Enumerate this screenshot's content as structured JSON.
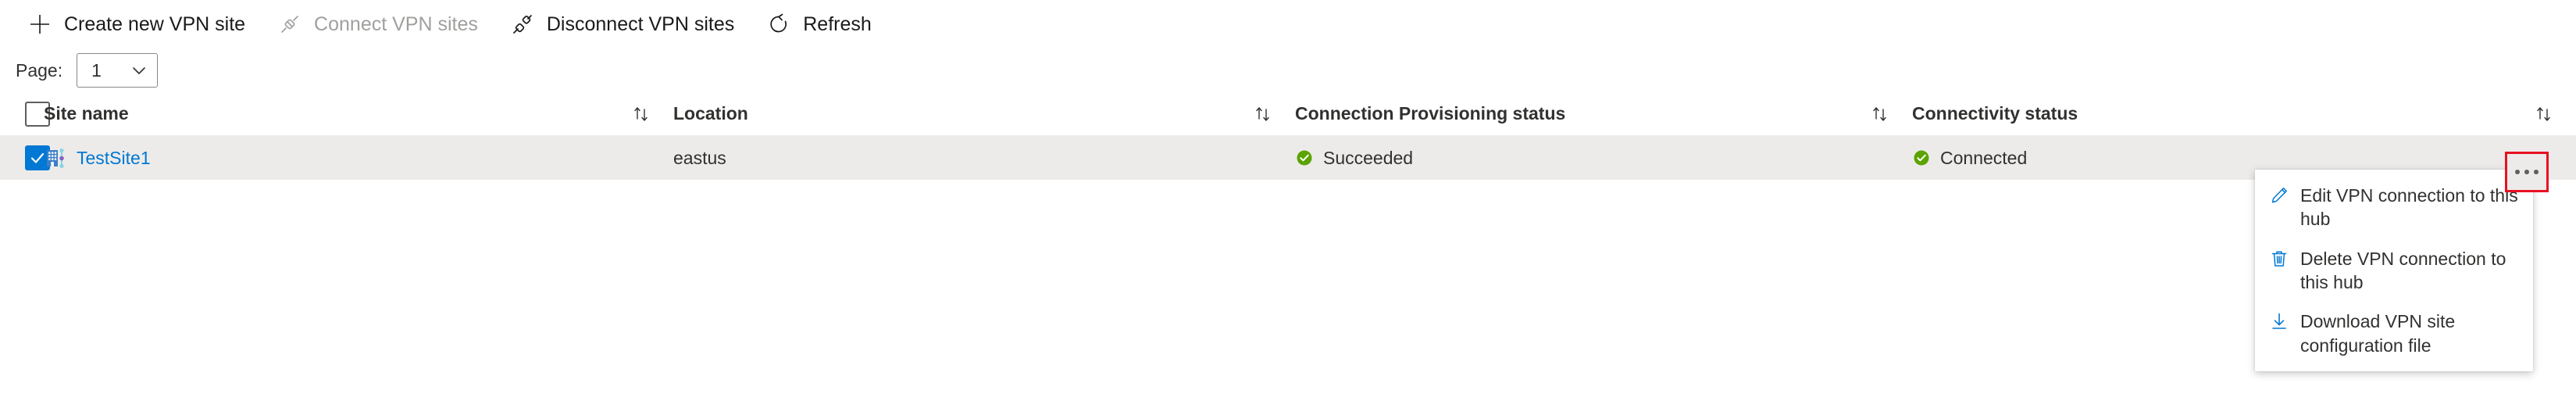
{
  "toolbar": {
    "buttons": [
      {
        "label": "Create new VPN site",
        "icon": "plus-icon",
        "disabled": false
      },
      {
        "label": "Connect VPN sites",
        "icon": "connect-plug-icon",
        "disabled": true
      },
      {
        "label": "Disconnect VPN sites",
        "icon": "disconnect-plug-icon",
        "disabled": false
      },
      {
        "label": "Refresh",
        "icon": "refresh-icon",
        "disabled": false
      }
    ]
  },
  "pager": {
    "label": "Page:",
    "value": "1",
    "options": [
      "1"
    ],
    "chevron_icon": "chevron-down-icon"
  },
  "grid": {
    "select_all_checkbox": {
      "icon": "checkbox-icon",
      "checked": false
    },
    "sort_icon": "sort-updown-icon",
    "columns": [
      {
        "key": "site_name",
        "label": "Site name",
        "sortable": true
      },
      {
        "key": "location",
        "label": "Location",
        "sortable": true
      },
      {
        "key": "provisioning_status",
        "label": "Connection Provisioning status",
        "sortable": true
      },
      {
        "key": "connectivity_status",
        "label": "Connectivity status",
        "sortable": true
      }
    ],
    "rows": [
      {
        "selected": true,
        "row_checkbox_icon": "checkbox-checked-icon",
        "site_icon": "vpn-site-icon",
        "site_name": "TestSite1",
        "location": "eastus",
        "provisioning_status": "Succeeded",
        "provisioning_status_icon": "success-check-icon",
        "connectivity_status": "Connected",
        "connectivity_status_icon": "success-check-icon",
        "more_actions_icon": "ellipsis-icon"
      }
    ]
  },
  "context_menu": {
    "items": [
      {
        "label": "Edit VPN connection to this hub",
        "icon": "pencil-icon"
      },
      {
        "label": "Delete VPN connection to this hub",
        "icon": "trash-icon"
      },
      {
        "label": "Download VPN site configuration file",
        "icon": "download-arrow-icon"
      }
    ]
  },
  "colors": {
    "accent": "#0078d4",
    "success": "#5ba300",
    "selected_row_bg": "#edebe9",
    "highlight_outline": "#e81123",
    "disabled_text": "#a19f9d"
  }
}
